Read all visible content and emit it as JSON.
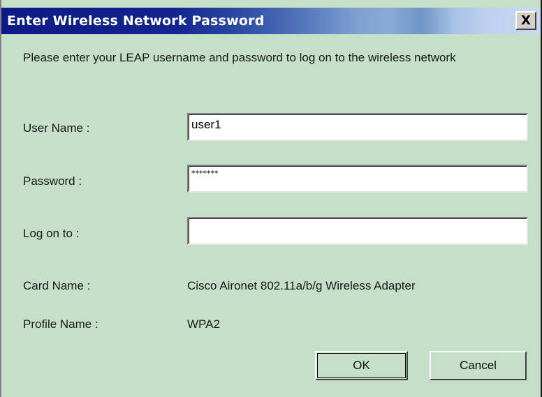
{
  "window": {
    "title": "Enter Wireless Network Password",
    "close_label": "X"
  },
  "intro_text": "Please enter your LEAP username and password to log on to the wireless network",
  "fields": {
    "username": {
      "label": "User Name :",
      "value": "user1"
    },
    "password": {
      "label": "Password :",
      "value": "*******"
    },
    "logon": {
      "label": "Log on to :",
      "value": ""
    }
  },
  "info": {
    "card_label": "Card Name :",
    "card_value": "Cisco Aironet 802.11a/b/g Wireless Adapter",
    "profile_label": "Profile Name :",
    "profile_value": "WPA2"
  },
  "buttons": {
    "ok": "OK",
    "cancel": "Cancel"
  },
  "colors": {
    "dialog_background": "#c5dfc8",
    "titlebar_start": "#0c1a86",
    "titlebar_end": "#c8dbf2"
  }
}
